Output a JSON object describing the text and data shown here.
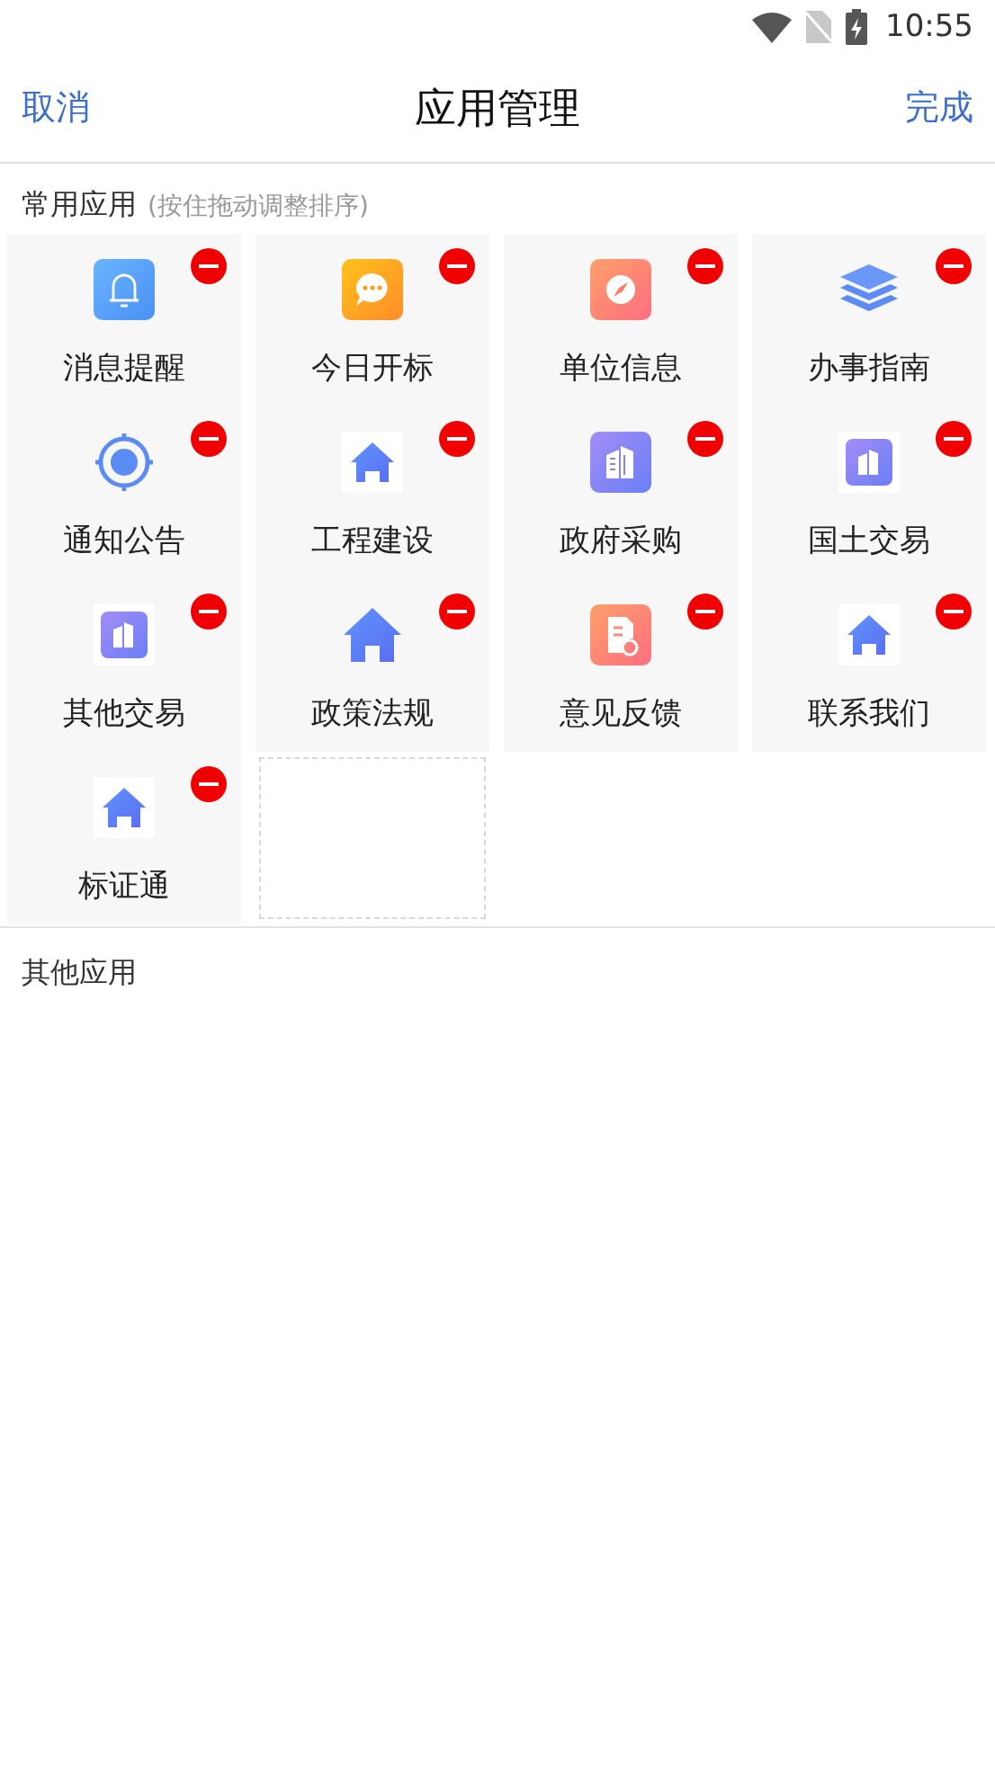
{
  "status_bar": {
    "time": "10:55"
  },
  "header": {
    "left_button": "取消",
    "title": "应用管理",
    "right_button": "完成"
  },
  "common_apps": {
    "title": "常用应用",
    "hint": "(按住拖动调整排序)",
    "items": [
      {
        "kind": "app",
        "label": "消息提醒",
        "removable": true
      },
      {
        "kind": "app",
        "label": "今日开标",
        "removable": true
      },
      {
        "kind": "app",
        "label": "单位信息",
        "removable": true
      },
      {
        "kind": "app",
        "label": "办事指南",
        "removable": true
      },
      {
        "kind": "app",
        "label": "通知公告",
        "removable": true
      },
      {
        "kind": "app",
        "label": "工程建设",
        "removable": true
      },
      {
        "kind": "app",
        "label": "政府采购",
        "removable": true
      },
      {
        "kind": "app",
        "label": "国土交易",
        "removable": true
      },
      {
        "kind": "app",
        "label": "其他交易",
        "removable": true
      },
      {
        "kind": "app",
        "label": "政策法规",
        "removable": true
      },
      {
        "kind": "app",
        "label": "意见反馈",
        "removable": true
      },
      {
        "kind": "app",
        "label": "联系我们",
        "removable": true
      },
      {
        "kind": "app",
        "label": "标证通",
        "removable": true
      },
      {
        "kind": "slot"
      }
    ]
  },
  "other_apps": {
    "title": "其他应用"
  }
}
